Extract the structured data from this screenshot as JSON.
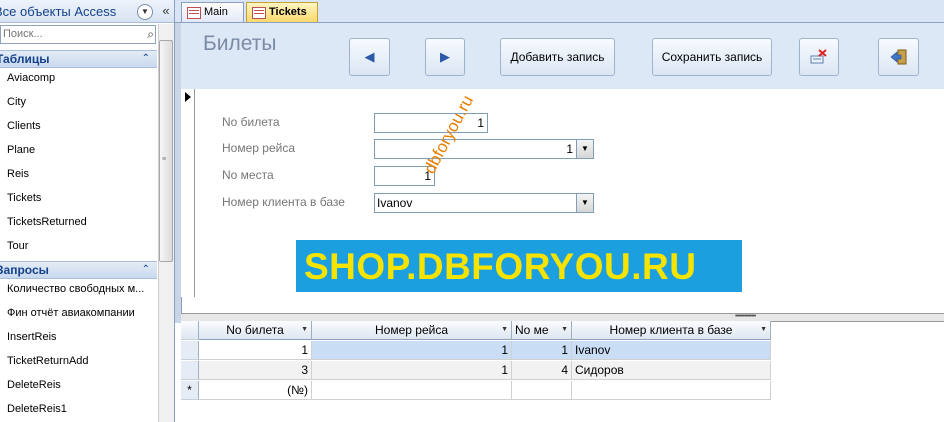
{
  "nav": {
    "title": "Все объекты Access",
    "search_placeholder": "Поиск...",
    "groups": [
      {
        "label": "Таблицы",
        "items": [
          "Aviacomp",
          "City",
          "Clients",
          "Plane",
          "Reis",
          "Tickets",
          "TicketsReturned",
          "Tour"
        ]
      },
      {
        "label": "Запросы",
        "items": [
          "Количество свободных м...",
          "Фин отчёт авиакомпании",
          "InsertReis",
          "TicketReturnAdd",
          "DeleteReis",
          "DeleteReis1"
        ]
      }
    ]
  },
  "tabs": [
    {
      "label": "Main",
      "active": false
    },
    {
      "label": "Tickets",
      "active": true
    }
  ],
  "form": {
    "title": "Билеты",
    "buttons": {
      "prev": "◀",
      "next": "▶",
      "add": "Добавить запись",
      "save": "Сохранить запись",
      "delete_icon": "delete-record-icon",
      "exit_icon": "exit-door-icon"
    },
    "fields": [
      {
        "label": "No билета",
        "value": "1"
      },
      {
        "label": "Номер рейса",
        "value": "1"
      },
      {
        "label": "No места",
        "value": "1"
      },
      {
        "label": "Номер клиента в базе",
        "value": "Ivanov"
      }
    ]
  },
  "watermark_text": "dbforyou.ru",
  "banner_text": "SHOP.DBFORYOU.RU",
  "datasheet": {
    "columns": [
      "No билета",
      "Номер рейса",
      "No ме",
      "Номер клиента в базе"
    ],
    "rows": [
      [
        "1",
        "1",
        "1",
        "Ivanov"
      ],
      [
        "3",
        "1",
        "4",
        "Сидоров"
      ]
    ],
    "new_row_marker": "*",
    "new_row_placeholder": "(№)"
  },
  "colors": {
    "accent": "#1c9fdf",
    "banner_text": "#f6e400",
    "watermark": "#e67e00",
    "selected_row": "#c9ddf5"
  }
}
